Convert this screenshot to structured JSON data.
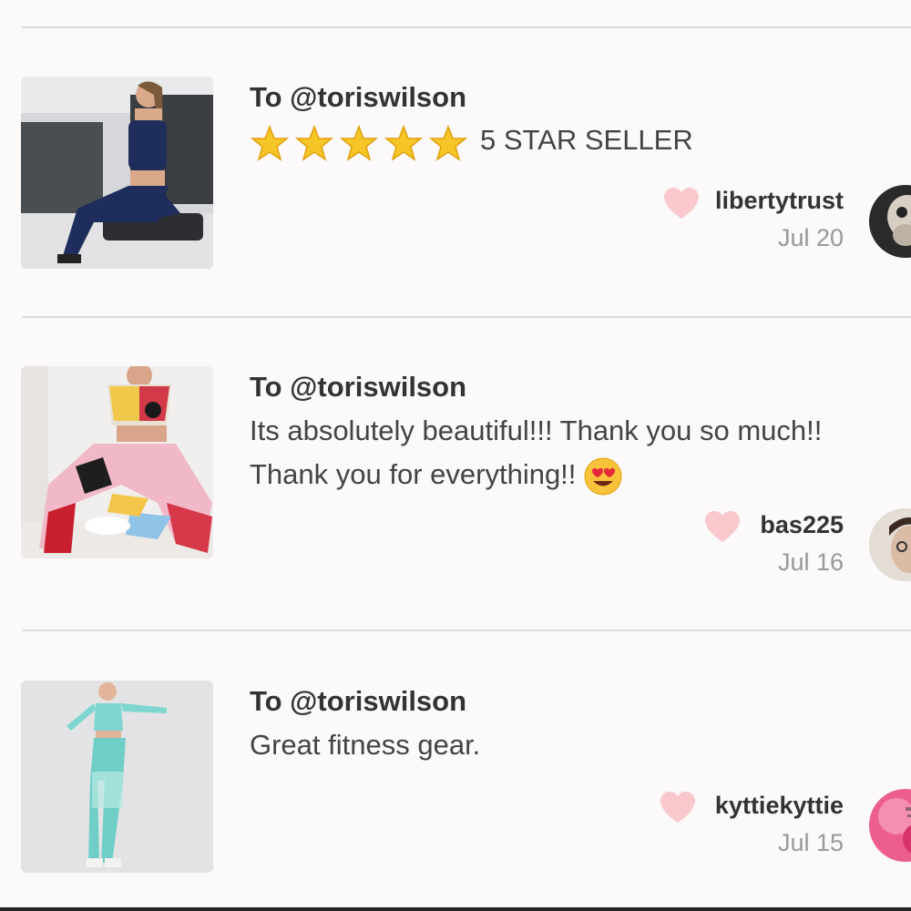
{
  "reviews": [
    {
      "to": "To @toriswilson",
      "star_count": 5,
      "text": "5 STAR SELLER",
      "username": "libertytrust",
      "date": "Jul 20",
      "thumb_colors": {
        "bg": "#c9ccd0",
        "outfit": "#1f2d5c",
        "skin": "#d9a98a"
      }
    },
    {
      "to": "To @toriswilson",
      "line1": "Its absolutely beautiful!!! Thank you so much!!",
      "line2": "Thank you for everything!!",
      "emoji": "heart-eyes-emoji",
      "username": "bas225",
      "date": "Jul 16"
    },
    {
      "to": "To @toriswilson",
      "text": "Great fitness gear.",
      "username": "kyttiekyttie",
      "date": "Jul 15"
    }
  ],
  "colors": {
    "heart": "#f8c8cc",
    "star": "#f6c528",
    "divider": "#dcdcdc",
    "background": "#fbf9fa"
  }
}
